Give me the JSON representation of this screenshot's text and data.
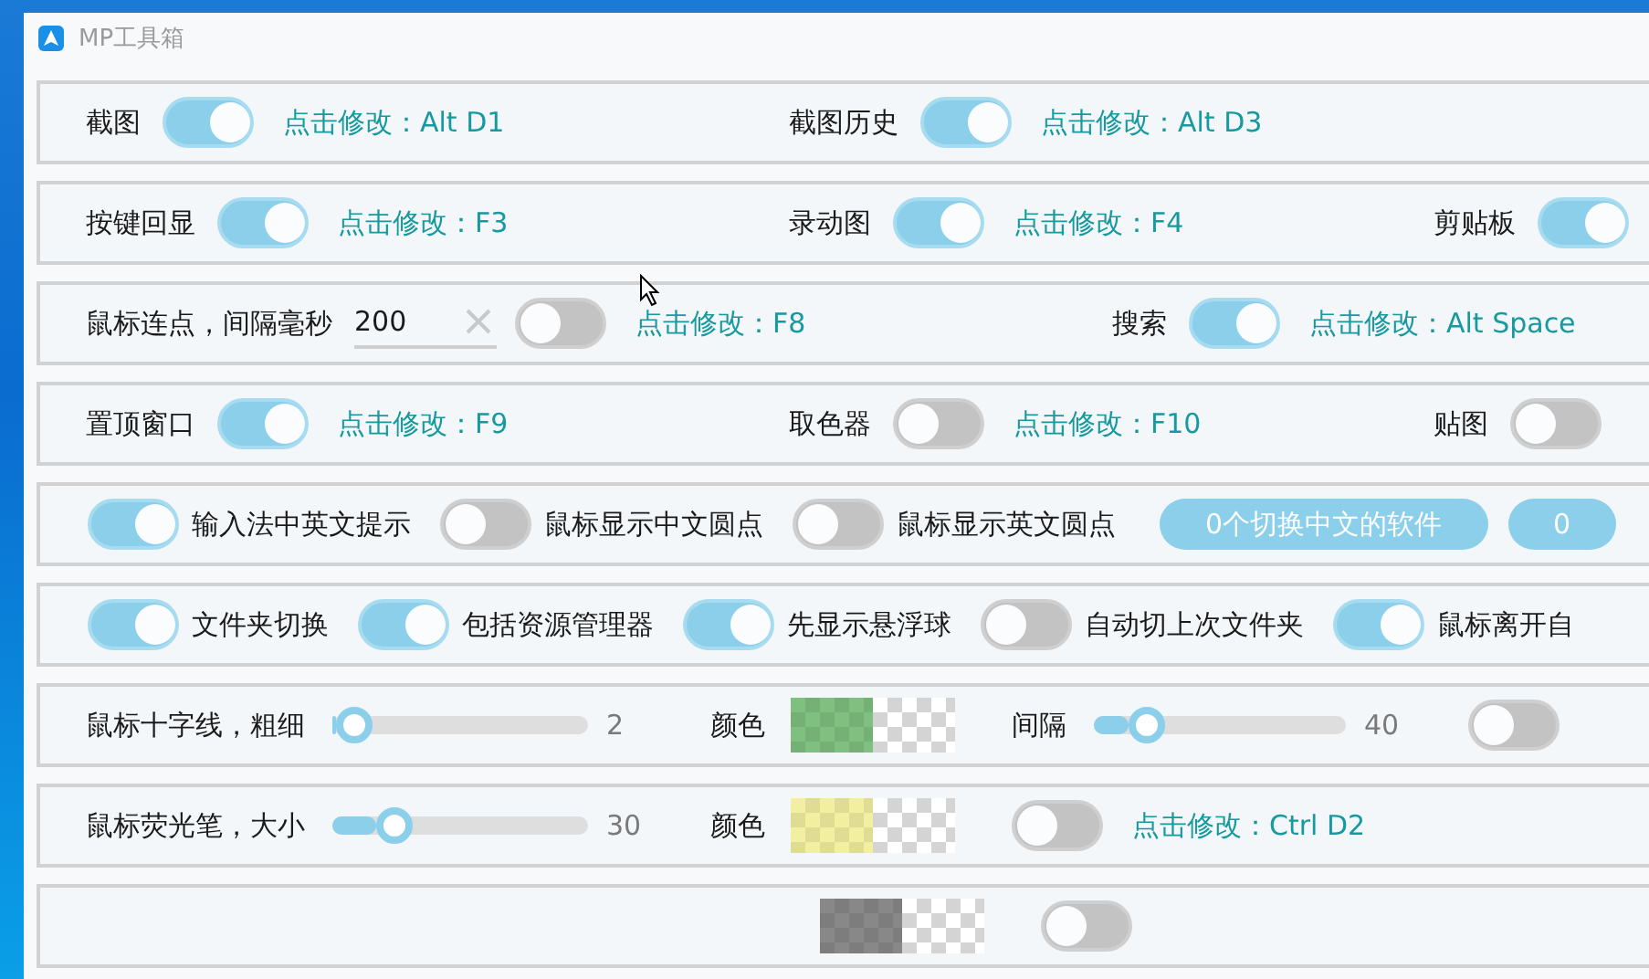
{
  "window": {
    "title": "MP工具箱"
  },
  "rows": [
    {
      "kind": "hotkeys",
      "items": [
        {
          "kind": "toggle",
          "label": "截图",
          "on": true,
          "hotkey": "点击修改：Alt D1"
        },
        {
          "kind": "toggle",
          "label": "截图历史",
          "on": true,
          "hotkey": "点击修改：Alt D3"
        }
      ]
    },
    {
      "kind": "hotkeys",
      "items": [
        {
          "kind": "toggle",
          "label": "按键回显",
          "on": true,
          "hotkey": "点击修改：F3"
        },
        {
          "kind": "toggle",
          "label": "录动图",
          "on": true,
          "hotkey": "点击修改：F4"
        },
        {
          "kind": "toggle",
          "label": "剪贴板",
          "on": true
        }
      ]
    },
    {
      "kind": "hotkeys",
      "items": [
        {
          "kind": "interval",
          "label": "鼠标连点，间隔毫秒",
          "value": "200",
          "on": false,
          "hotkey": "点击修改：F8"
        },
        {
          "kind": "toggle",
          "label": "搜索",
          "on": true,
          "hotkey": "点击修改：Alt Space"
        }
      ]
    },
    {
      "kind": "hotkeys",
      "items": [
        {
          "kind": "toggle",
          "label": "置顶窗口",
          "on": true,
          "hotkey": "点击修改：F9"
        },
        {
          "kind": "toggle",
          "label": "取色器",
          "on": false,
          "hotkey": "点击修改：F10"
        },
        {
          "kind": "toggle",
          "label": "贴图",
          "on": false
        }
      ]
    },
    {
      "kind": "switches",
      "items": [
        {
          "label": "输入法中英文提示",
          "on": true
        },
        {
          "label": "鼠标显示中文圆点",
          "on": false
        },
        {
          "label": "鼠标显示英文圆点",
          "on": false
        }
      ],
      "buttons": [
        "0个切换中文的软件",
        "0"
      ]
    },
    {
      "kind": "switches",
      "items": [
        {
          "label": "文件夹切换",
          "on": true
        },
        {
          "label": "包括资源管理器",
          "on": true
        },
        {
          "label": "先显示悬浮球",
          "on": true
        },
        {
          "label": "自动切上次文件夹",
          "on": false
        },
        {
          "label": "鼠标离开自",
          "on": true
        }
      ]
    },
    {
      "kind": "sliders",
      "items": [
        {
          "kind": "slider",
          "label": "鼠标十字线，粗细",
          "level": 0.02,
          "reading": "2"
        },
        {
          "kind": "color",
          "label": "颜色",
          "color": "#7fbf7f"
        },
        {
          "kind": "slider",
          "label": "间隔",
          "level": 0.16,
          "reading": "40"
        },
        {
          "kind": "toggle",
          "on": false
        }
      ]
    },
    {
      "kind": "sliders",
      "items": [
        {
          "kind": "slider",
          "label": "鼠标荧光笔，大小",
          "level": 0.2,
          "reading": "30"
        },
        {
          "kind": "color",
          "label": "颜色",
          "color": "#f2f0a0"
        },
        {
          "kind": "toggle",
          "on": false,
          "hotkey": "点击修改：Ctrl D2"
        }
      ]
    },
    {
      "kind": "partial",
      "items": [
        {
          "kind": "color",
          "color": "#888888"
        },
        {
          "kind": "toggle",
          "on": false
        }
      ]
    }
  ]
}
